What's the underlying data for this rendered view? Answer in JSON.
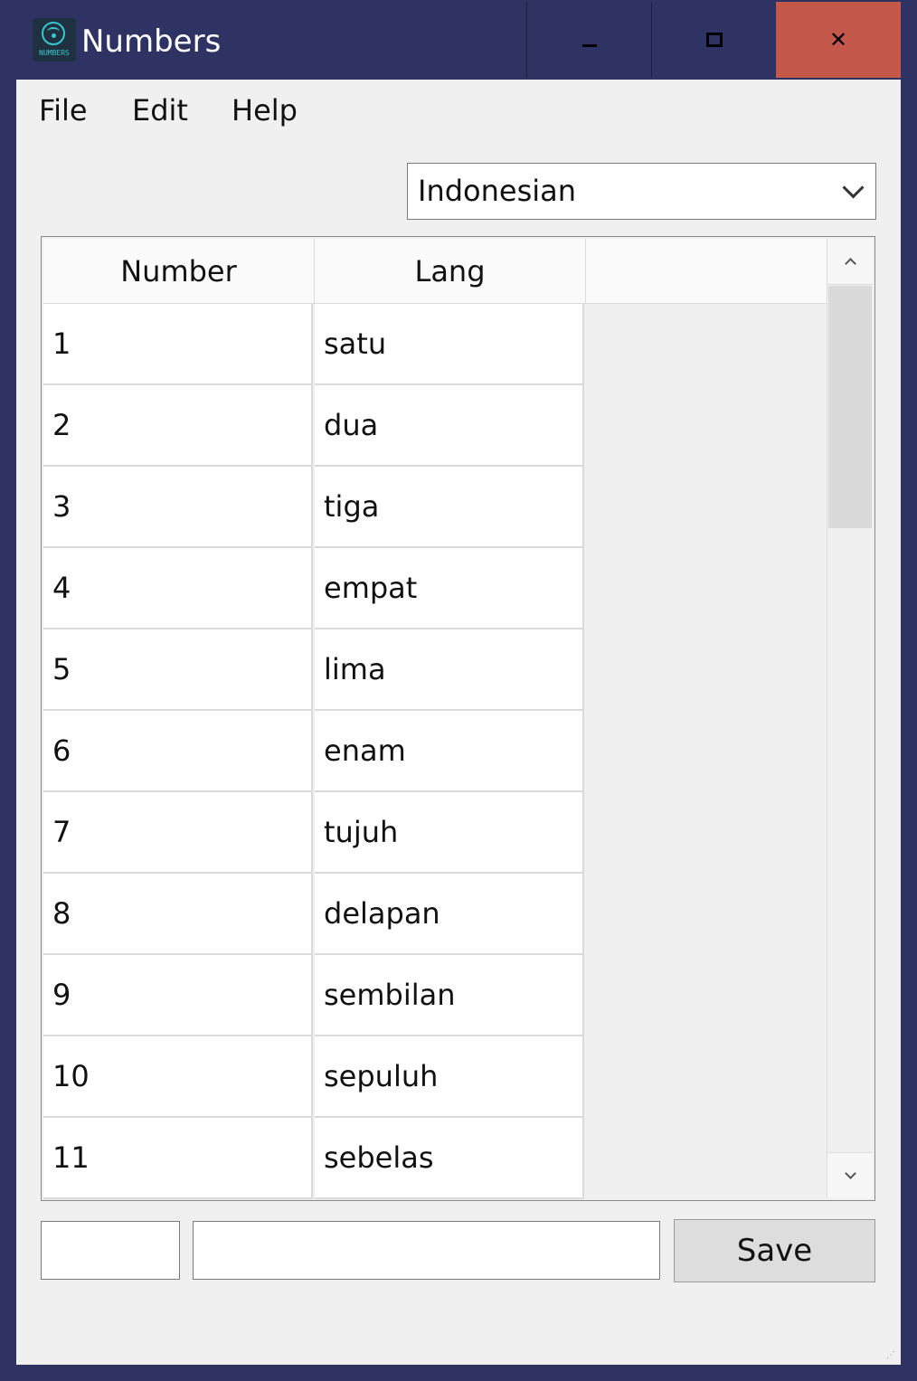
{
  "window": {
    "title": "Numbers",
    "icon": "numbers-app-icon",
    "icon_text": "NUMBERS",
    "controls": {
      "minimize": "minimize-icon",
      "maximize": "maximize-icon",
      "close": "close-icon"
    }
  },
  "menu": {
    "file": "File",
    "edit": "Edit",
    "help": "Help"
  },
  "language_select": {
    "value": "Indonesian"
  },
  "grid": {
    "headers": {
      "number": "Number",
      "lang": "Lang"
    },
    "rows": [
      {
        "number": "1",
        "lang": "satu"
      },
      {
        "number": "2",
        "lang": "dua"
      },
      {
        "number": "3",
        "lang": "tiga"
      },
      {
        "number": "4",
        "lang": "empat"
      },
      {
        "number": "5",
        "lang": "lima"
      },
      {
        "number": "6",
        "lang": "enam"
      },
      {
        "number": "7",
        "lang": "tujuh"
      },
      {
        "number": "8",
        "lang": "delapan"
      },
      {
        "number": "9",
        "lang": "sembilan"
      },
      {
        "number": "10",
        "lang": "sepuluh"
      },
      {
        "number": "11",
        "lang": "sebelas"
      }
    ]
  },
  "inputs": {
    "number_value": "",
    "lang_value": ""
  },
  "actions": {
    "save_label": "Save"
  },
  "colors": {
    "titlebar": "#2f3364",
    "close_button": "#c4584b",
    "client": "#f0f0f0"
  }
}
